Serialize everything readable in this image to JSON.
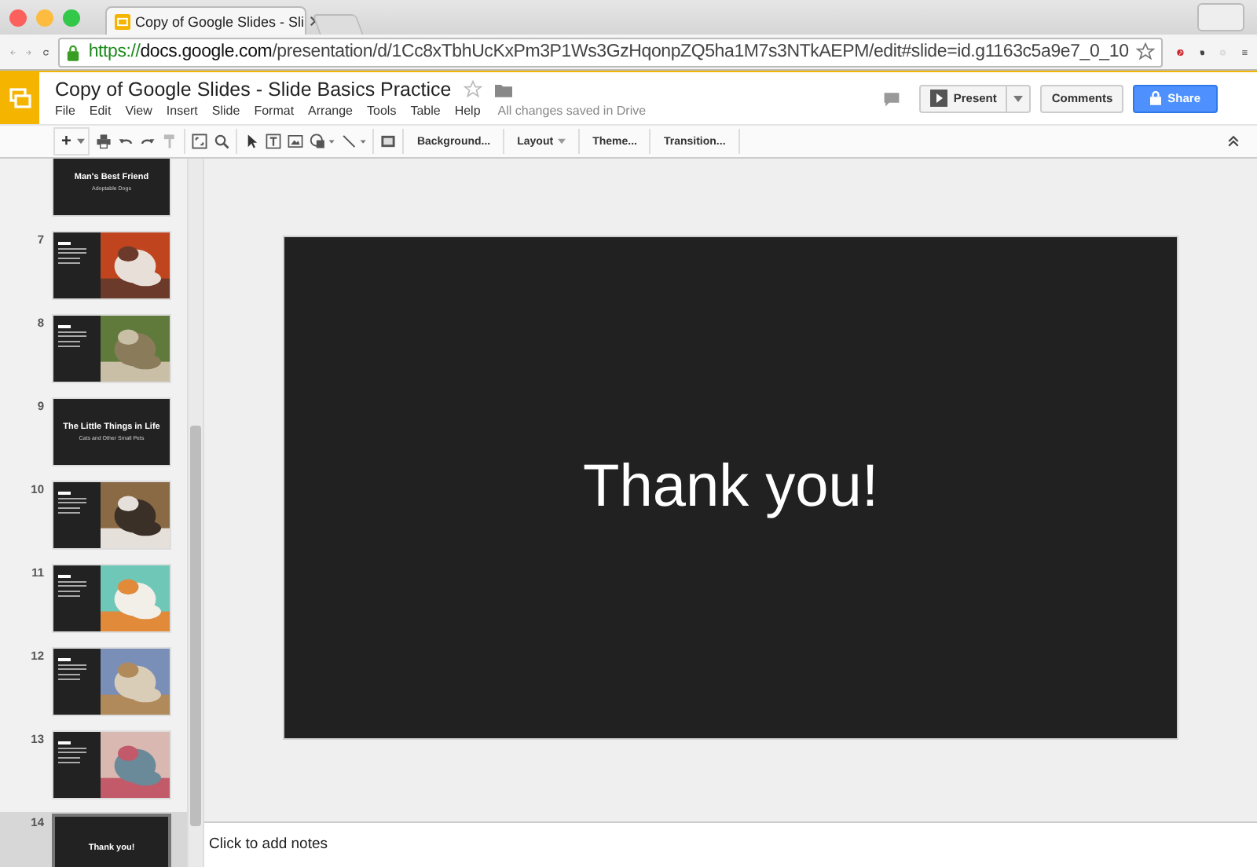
{
  "browser": {
    "tab_title": "Copy of Google Slides - Sli",
    "url_scheme": "https://",
    "url_host": "docs.google.com",
    "url_path": "/presentation/d/1Cc8xTbhUcKxPm3P1Ws3GzHqonpZQ5ha1M7s3NTkAEPM/edit#slide=id.g1163c5a9e7_0_10"
  },
  "document": {
    "title": "Copy of Google Slides - Slide Basics Practice",
    "save_status": "All changes saved in Drive"
  },
  "menu": [
    "File",
    "Edit",
    "View",
    "Insert",
    "Slide",
    "Format",
    "Arrange",
    "Tools",
    "Table",
    "Help"
  ],
  "header_buttons": {
    "present": "Present",
    "comments": "Comments",
    "share": "Share"
  },
  "toolbar": {
    "plus": "+",
    "text_buttons": [
      "Background...",
      "Layout",
      "Theme...",
      "Transition..."
    ]
  },
  "slides": [
    {
      "kind": "title",
      "title": "Man's Best Friend",
      "subtitle": "Adoptable Dogs",
      "selected": false
    },
    {
      "number": "7",
      "selected": false
    },
    {
      "number": "8",
      "selected": false
    },
    {
      "number": "9",
      "kind": "title",
      "title": "The Little Things in Life",
      "subtitle": "Cats and Other Small Pets",
      "selected": false
    },
    {
      "number": "10",
      "selected": false
    },
    {
      "number": "11",
      "selected": false
    },
    {
      "number": "12",
      "selected": false
    },
    {
      "number": "13",
      "selected": false
    },
    {
      "number": "14",
      "kind": "title",
      "title": "Thank you!",
      "selected": true
    }
  ],
  "current_slide": {
    "text": "Thank you!"
  },
  "notes": {
    "placeholder": "Click to add notes"
  }
}
